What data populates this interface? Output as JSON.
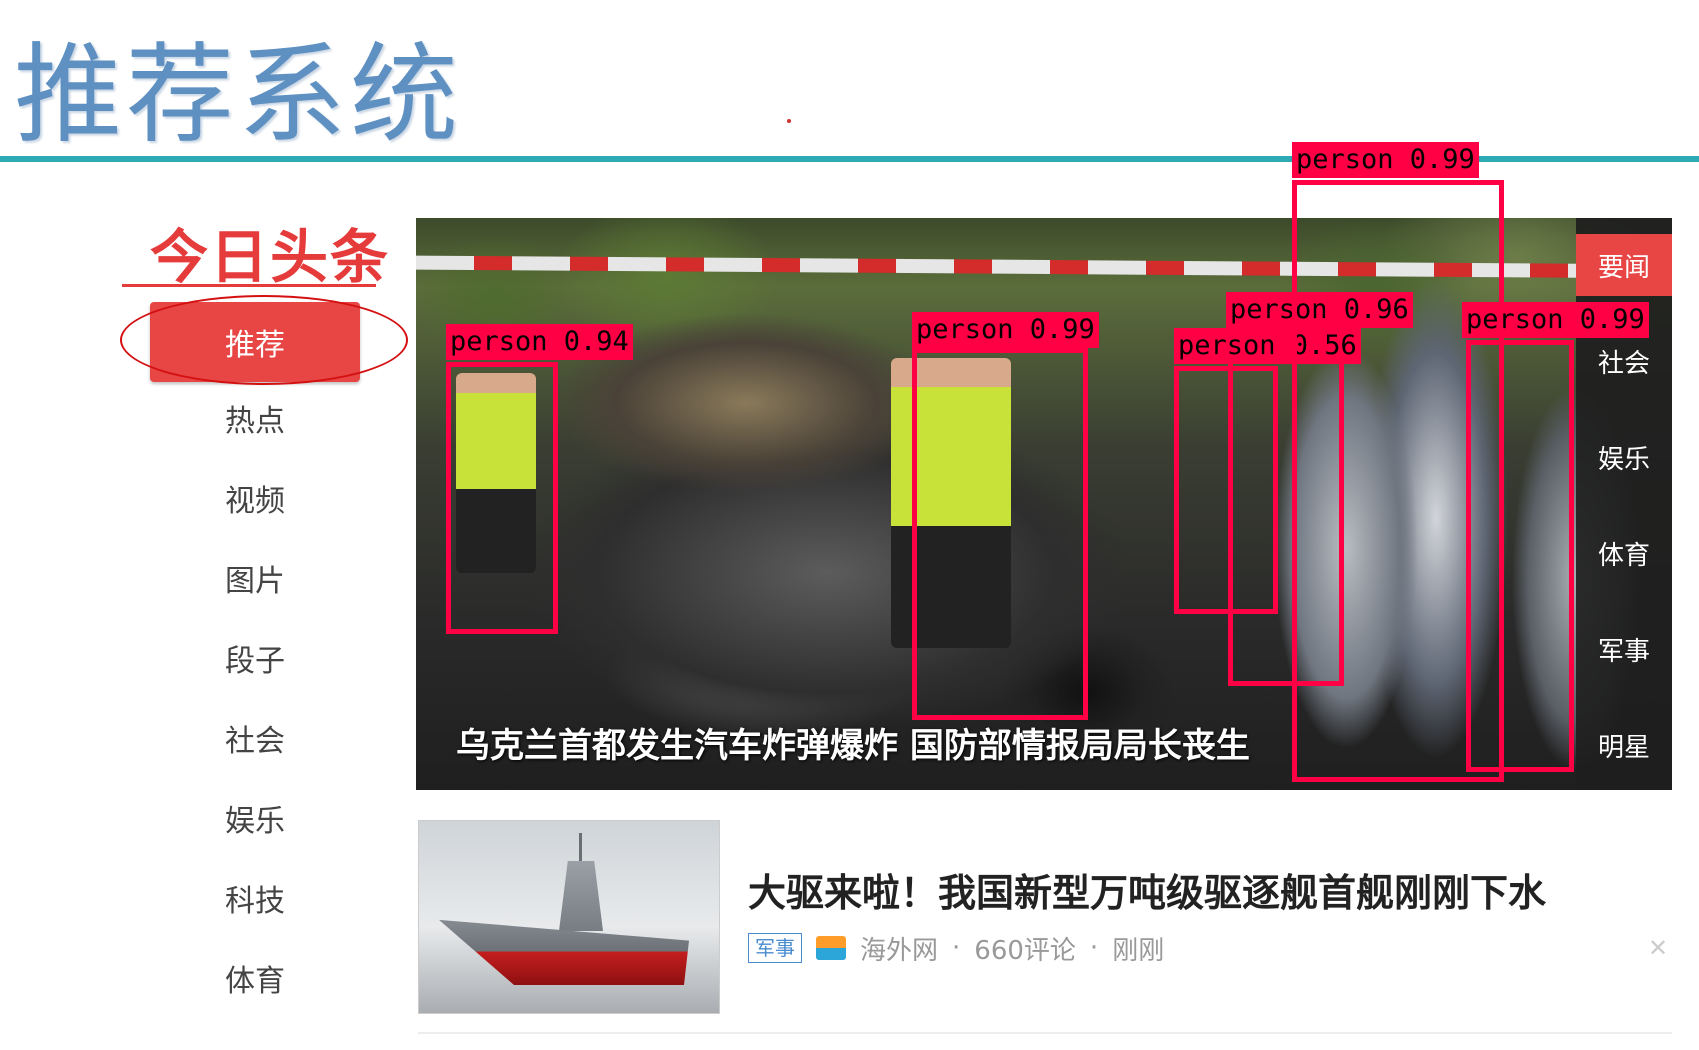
{
  "slide": {
    "title": "推荐系统"
  },
  "sidebar": {
    "logo": "今日头条",
    "items": [
      {
        "label": "推荐",
        "active": true
      },
      {
        "label": "热点"
      },
      {
        "label": "视频"
      },
      {
        "label": "图片"
      },
      {
        "label": "段子"
      },
      {
        "label": "社会"
      },
      {
        "label": "娱乐"
      },
      {
        "label": "科技"
      },
      {
        "label": "体育"
      }
    ]
  },
  "hero": {
    "caption": "乌克兰首都发生汽车炸弹爆炸 国防部情报局局长丧生",
    "side_tabs": [
      {
        "label": "要闻",
        "active": true
      },
      {
        "label": "社会"
      },
      {
        "label": "娱乐"
      },
      {
        "label": "体育"
      },
      {
        "label": "军事"
      },
      {
        "label": "明星"
      }
    ],
    "detections": [
      {
        "label": "person 0.94"
      },
      {
        "label": "person 0.99"
      },
      {
        "label": "person 0.56"
      },
      {
        "label": "person 0.96"
      },
      {
        "label": "person 0.99"
      },
      {
        "label": "person 0.99"
      }
    ]
  },
  "news": {
    "title": "大驱来啦！我国新型万吨级驱逐舰首舰刚刚下水",
    "tag": "军事",
    "source": "海外网",
    "comments": "660评论",
    "time": "刚刚",
    "separator": "·",
    "close": "✕"
  },
  "colors": {
    "accent_red": "#e84545",
    "title_blue": "#5f90c2",
    "rule_teal": "#2eaab4",
    "detection_box": "#ff0044"
  }
}
